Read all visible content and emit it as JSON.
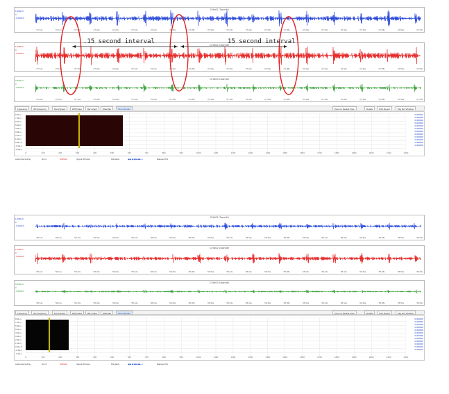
{
  "screens": [
    {
      "traces": [
        {
          "title": "CH#01 Tone/Hi",
          "color": "#2040d8",
          "y_ticks": [
            "1.000mV",
            "0",
            "-1.000mV"
          ]
        },
        {
          "title": "CH#02 channel",
          "color": "#e41a1a",
          "y_ticks": [
            "1.000mV",
            "0",
            "-1.000mV"
          ]
        },
        {
          "title": "CH#03 channel",
          "color": "#2e9b2e",
          "y_ticks": [
            "0.500mV",
            "0",
            "-0.500mV"
          ]
        }
      ],
      "time_ticks": [
        "07:12s",
        "07:14s",
        "07:16s",
        "07:18s",
        "07:20s",
        "07:22s",
        "07:24s",
        "07:26s",
        "07:28s",
        "07:30s",
        "07:32s",
        "07:34s",
        "07:36s",
        "07:38s",
        "07:40s",
        "07:42s",
        "07:44s",
        "07:46s",
        "07:48s",
        "07:50s",
        "07:52s"
      ],
      "annotations": [
        ".15 second interval",
        "15 second interval"
      ],
      "tabs": [
        "Frequency",
        "3D Frequency",
        "Fluid Speed",
        "RPM Data",
        "Bar Graph",
        "Waterfall",
        "Time Domain"
      ],
      "right_buttons": [
        "Zoom to Default View",
        "Details",
        "Print Report",
        "Pkg Ref Vibration"
      ],
      "spectro_left_ticks": [
        "8.0E-1",
        "7.0E-1",
        "6.0E-1",
        "5.0E-1",
        "4.0E-1",
        "3.0E-1",
        "2.0E-1",
        "1.0E-1",
        "0.0E+0",
        "-1.0E-1",
        "-2.0E-1"
      ],
      "spectro_right_ticks": [
        "0.000000",
        "0.000000",
        "0.000000",
        "0.000000",
        "0.000000",
        "0.000000",
        "0.000000",
        "0.000000",
        "0.000000",
        "0.000000",
        "0.000000",
        "0.000000"
      ],
      "spectro_x_ticks": [
        "0",
        "100",
        "200",
        "300",
        "400",
        "500",
        "600",
        "700",
        "800",
        "900",
        "1000",
        "1100",
        "1200",
        "1300",
        "1400",
        "1500",
        "1600",
        "1700",
        "1800",
        "1900",
        "2000",
        "2100",
        "2200"
      ],
      "status": {
        "left": "Audio Recording",
        "hours": "Hrs 0",
        "mode": "SIGNAL",
        "signal": "Signal Window",
        "playback": "Playback",
        "elapsed": "Elapsed 0%"
      }
    },
    {
      "traces": [
        {
          "title": "CH#01 Tone/Hi",
          "color": "#2040d8",
          "y_ticks": [
            "1.000mV",
            "0",
            "-1.000mV"
          ]
        },
        {
          "title": "CH#02 channel",
          "color": "#e41a1a",
          "y_ticks": [
            "1.000mV",
            "0",
            "-1.000mV"
          ]
        },
        {
          "title": "CH#03 channel",
          "color": "#2e9b2e",
          "y_ticks": [
            "0.500mV",
            "0",
            "-0.500mV"
          ]
        }
      ],
      "time_ticks": [
        "58.12s",
        "58.14s",
        "58.16s",
        "58.18s",
        "58.20s",
        "58.22s",
        "58.24s",
        "58.26s",
        "58.28s",
        "58.30s",
        "58.32s",
        "58.34s",
        "58.36s",
        "58.38s",
        "58.40s",
        "58.42s",
        "58.44s",
        "58.46s",
        "58.48s",
        "58.50s",
        "58.52s"
      ],
      "tabs": [
        "Frequency",
        "3D Frequency",
        "Fluid Speed",
        "RPM Data",
        "Bar Graph",
        "Waterfall",
        "Time Domain"
      ],
      "right_buttons": [
        "Zoom to Default View",
        "Details",
        "Print Report",
        "Pkg Ref Vibration"
      ],
      "spectro_left_ticks": [
        "8.0E-1",
        "7.0E-1",
        "6.0E-1",
        "5.0E-1",
        "4.0E-1",
        "3.0E-1",
        "2.0E-1",
        "1.0E-1",
        "0.0E+0",
        "-1.0E-1",
        "-2.0E-1"
      ],
      "spectro_right_ticks": [
        "0.000000",
        "0.000000",
        "0.000000",
        "0.000000",
        "0.000000",
        "0.000000",
        "0.000000",
        "0.000000",
        "0.000000",
        "0.000000",
        "0.000000",
        "0.000000"
      ],
      "spectro_x_ticks": [
        "0",
        "100",
        "200",
        "300",
        "400",
        "500",
        "600",
        "700",
        "800",
        "900",
        "1000",
        "1100",
        "1200",
        "1300",
        "1400",
        "1500",
        "1600",
        "1700",
        "1800",
        "1900",
        "2000",
        "2100",
        "2200"
      ],
      "status": {
        "left": "Audio Recording",
        "hours": "Hrs 0",
        "mode": "SIGNAL",
        "signal": "Signal Window",
        "playback": "Playback",
        "elapsed": "Elapsed 0%"
      }
    }
  ],
  "colors": {
    "highlight": "#e02020",
    "spectrum_fill": "#2a0505",
    "spectrum_fill_2": "#050505",
    "marker": "#c9b400",
    "accent_blue": "#1d47c4"
  }
}
